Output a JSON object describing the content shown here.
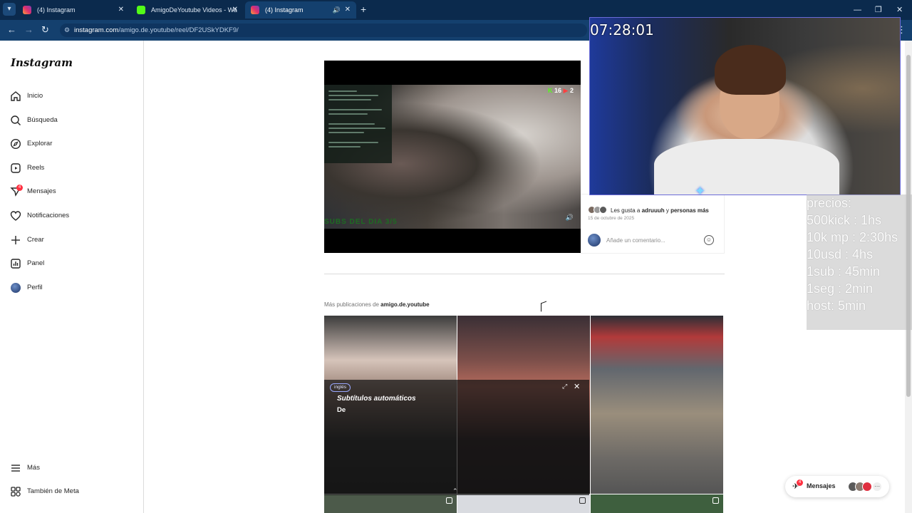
{
  "browser": {
    "tabs": [
      {
        "title": "(4) Instagram",
        "active": false,
        "icon": "instagram-icon"
      },
      {
        "title": "AmigoDeYoutube Videos - Wa",
        "active": false,
        "icon": "kick-icon"
      },
      {
        "title": "(4) Instagram",
        "active": true,
        "icon": "instagram-icon"
      }
    ],
    "url_host": "instagram.com",
    "url_path": "/amigo.de.youtube/reel/DF2USkYDKF9/"
  },
  "sidebar": {
    "logo": "Instagram",
    "items": [
      {
        "label": "Inicio",
        "icon": "home-icon"
      },
      {
        "label": "Búsqueda",
        "icon": "search-icon"
      },
      {
        "label": "Explorar",
        "icon": "compass-icon"
      },
      {
        "label": "Reels",
        "icon": "reels-icon"
      },
      {
        "label": "Mensajes",
        "icon": "messenger-icon",
        "badge": "4"
      },
      {
        "label": "Notificaciones",
        "icon": "heart-icon"
      },
      {
        "label": "Crear",
        "icon": "plus-icon"
      },
      {
        "label": "Panel",
        "icon": "chart-icon"
      },
      {
        "label": "Perfil",
        "icon": "avatar"
      }
    ],
    "bottom_items": [
      {
        "label": "Más",
        "icon": "menu-icon"
      },
      {
        "label": "También de Meta",
        "icon": "meta-icon"
      }
    ]
  },
  "reel": {
    "kick_viewers": "16",
    "yt_viewers": "2",
    "overlay_caption": "SUBS DEL DIA 3/5"
  },
  "post": {
    "likes_prefix": "Les gusta a",
    "likes_user": "adruuuh",
    "likes_join": "y",
    "likes_others": "personas más",
    "date": "15 de octubre de 2025",
    "comment_placeholder": "Añade un comentario..."
  },
  "more_posts": {
    "prefix": "Más publicaciones de",
    "account": "amigo.de.youtube"
  },
  "subtitles": {
    "language": "inglés",
    "title": "Subtítulos automáticos",
    "text": "De"
  },
  "messages_pill": {
    "label": "Mensajes",
    "badge": "4"
  },
  "stream": {
    "timer": "07:28:01",
    "prices": [
      "precios:",
      "500kick : 1hs",
      "10k mp : 2:30hs",
      "10usd : 4hs",
      "1sub : 45min",
      "1seg : 2min",
      "host: 5min"
    ]
  },
  "colors": {
    "chrome_dark": "#0b2a4d",
    "chrome": "#14406e",
    "badge": "#ff3040"
  }
}
